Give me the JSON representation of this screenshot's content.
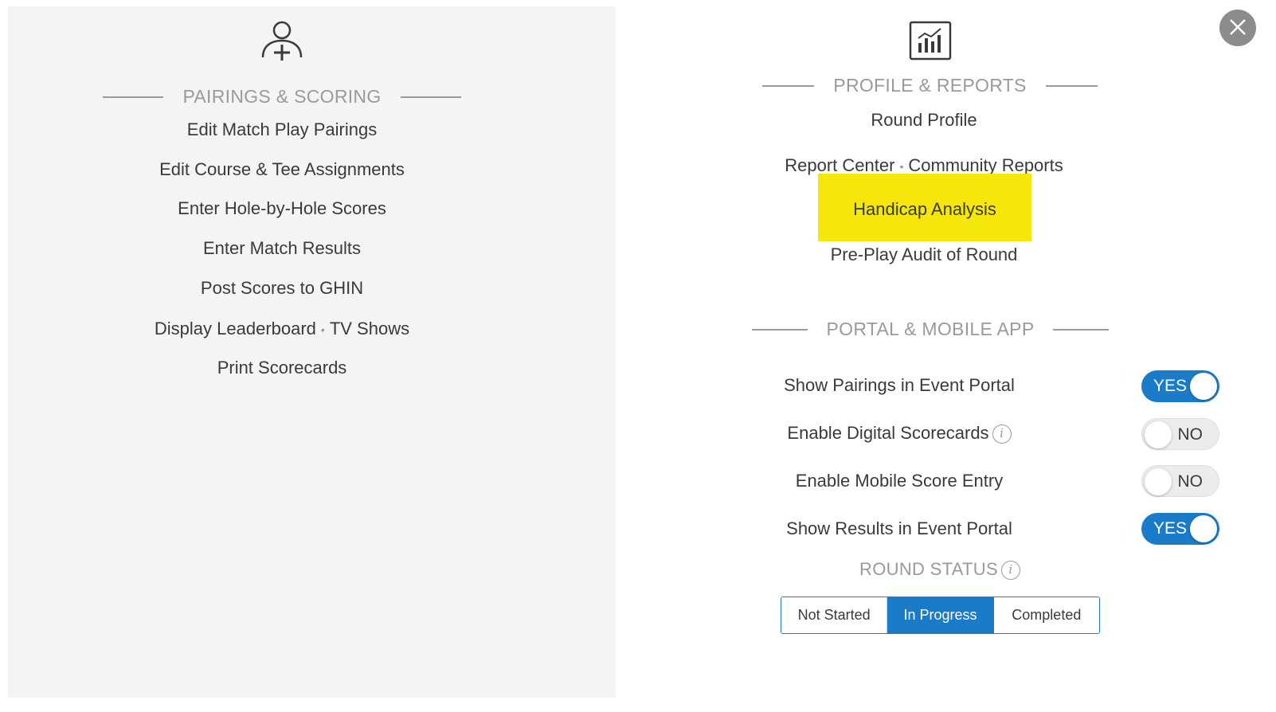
{
  "pairings_scoring": {
    "icon": "add-user-icon",
    "title": "PAIRINGS & SCORING",
    "links": [
      "Edit Match Play Pairings",
      "Edit Course & Tee Assignments",
      "Enter Hole-by-Hole Scores",
      "Enter Match Results",
      "Post Scores to GHIN",
      "Display Leaderboard",
      "TV Shows",
      "Print Scorecards"
    ]
  },
  "profile_reports": {
    "icon": "chart-icon",
    "title": "PROFILE & REPORTS",
    "round_profile": "Round Profile",
    "report_center": "Report Center",
    "community_reports": "Community Reports",
    "handicap_analysis": "Handicap Analysis",
    "pre_play_audit": "Pre-Play Audit of Round"
  },
  "portal_mobile": {
    "title": "PORTAL & MOBILE APP",
    "toggles": [
      {
        "label": "Show Pairings in Event Portal",
        "state": "YES"
      },
      {
        "label": "Enable Digital Scorecards",
        "state": "NO"
      },
      {
        "label": "Enable Mobile Score Entry",
        "state": "NO"
      },
      {
        "label": "Show Results in Event Portal",
        "state": "YES"
      }
    ]
  },
  "round_status": {
    "title": "ROUND STATUS",
    "options": [
      "Not Started",
      "In Progress",
      "Completed"
    ],
    "selected": "In Progress"
  },
  "info_glyph": "i",
  "separator_glyph": "•",
  "colors": {
    "accent": "#1a7bc9",
    "highlight": "#f5e70c",
    "panel_bg": "#f4f4f4",
    "muted_text": "#9a9a9a"
  }
}
